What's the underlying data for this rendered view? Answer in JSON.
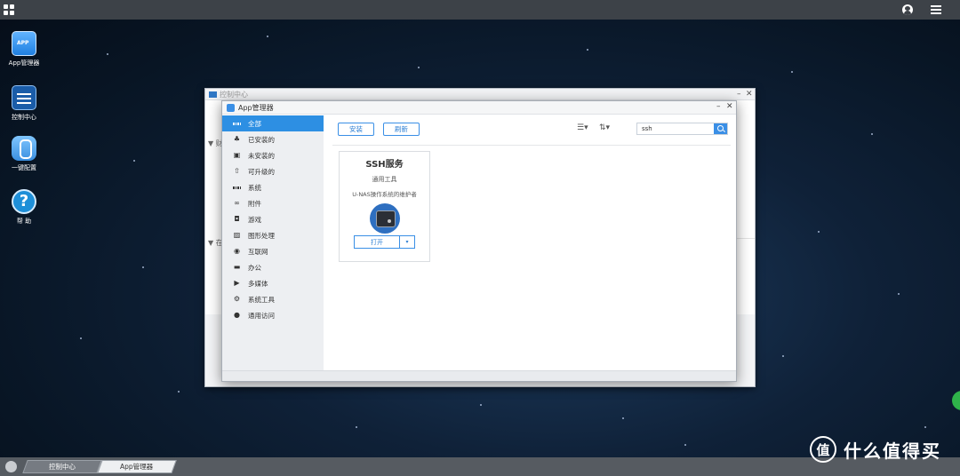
{
  "desktop": {
    "icons": [
      {
        "label": "App管理器",
        "icon": "app-manager-icon"
      },
      {
        "label": "控制中心",
        "icon": "control-center-icon"
      },
      {
        "label": "一键配置",
        "icon": "one-key-config-icon"
      },
      {
        "label": "帮 助",
        "icon": "help-icon"
      }
    ]
  },
  "control_center_window": {
    "title": "控制中心",
    "partial_text_1": "财",
    "partial_text_2": "在"
  },
  "app_manager_window": {
    "title": "App管理器",
    "sidebar": [
      {
        "label": "全部",
        "icon": "grid-icon",
        "active": true
      },
      {
        "label": "已安装的",
        "icon": "installed-icon"
      },
      {
        "label": "未安装的",
        "icon": "not-installed-icon"
      },
      {
        "label": "可升级的",
        "icon": "upgrade-icon"
      },
      {
        "label": "系统",
        "icon": "windows-icon"
      },
      {
        "label": "附件",
        "icon": "link-icon"
      },
      {
        "label": "游戏",
        "icon": "gamepad-icon"
      },
      {
        "label": "图形处理",
        "icon": "image-icon"
      },
      {
        "label": "互联网",
        "icon": "globe-icon"
      },
      {
        "label": "办公",
        "icon": "briefcase-icon"
      },
      {
        "label": "多媒体",
        "icon": "play-icon"
      },
      {
        "label": "系统工具",
        "icon": "gear-icon"
      },
      {
        "label": "通用访问",
        "icon": "user-icon"
      }
    ],
    "toolbar": {
      "install_label": "安装",
      "refresh_label": "刷新",
      "search_value": "ssh"
    },
    "app_card": {
      "name": "SSH服务",
      "category": "通用工具",
      "description": "U-NAS操作系统的维护者",
      "open_label": "打开",
      "dropdown_glyph": "▾"
    }
  },
  "taskbar": {
    "tasks": [
      {
        "label": "控制中心",
        "active": false
      },
      {
        "label": "App管理器",
        "active": true
      }
    ]
  },
  "watermark": {
    "badge": "值",
    "text": "什么值得买"
  },
  "colors": {
    "accent": "#2d8fe3",
    "topbar": "#3d4248",
    "taskbar": "#565b61"
  }
}
